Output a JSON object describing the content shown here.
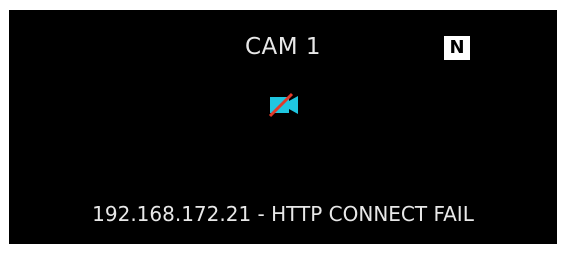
{
  "camera": {
    "title": "CAM 1",
    "badge": "N",
    "status_icon": "camera-off-icon",
    "status_line": "192.168.172.21 - HTTP CONNECT FAIL"
  },
  "colors": {
    "background": "#000000",
    "text": "#e8e8e8",
    "icon_body": "#1fc6e0",
    "icon_slash": "#e23a2a"
  }
}
